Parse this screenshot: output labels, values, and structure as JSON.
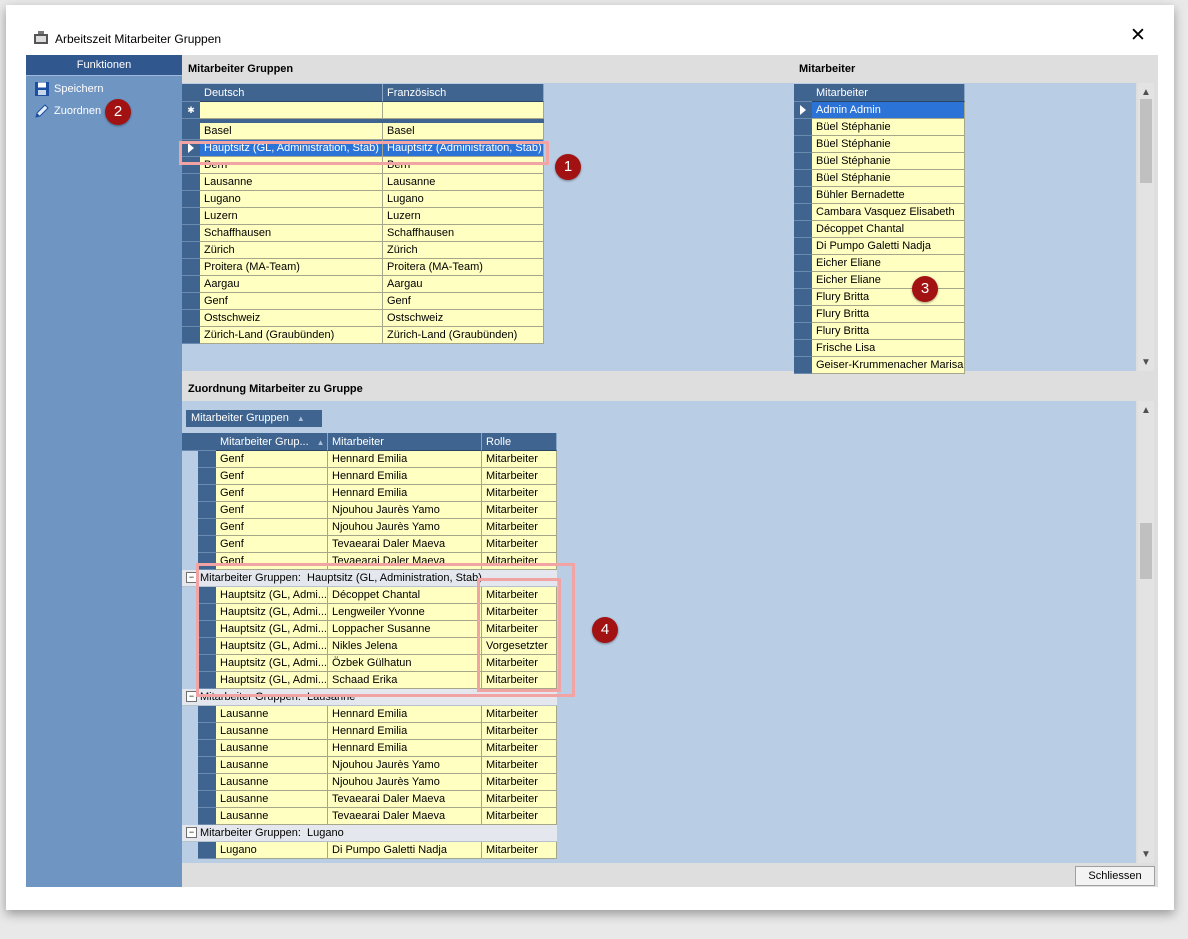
{
  "window": {
    "title": "Arbeitszeit Mitarbeiter Gruppen",
    "close_glyph": "✕"
  },
  "sidebar": {
    "header": "Funktionen",
    "items": [
      {
        "label": "Speichern",
        "icon": "save-icon"
      },
      {
        "label": "Zuordnen",
        "icon": "pencil-icon"
      }
    ]
  },
  "groups_section": {
    "title": "Mitarbeiter Gruppen",
    "columns": [
      "Deutsch",
      "Französisch"
    ],
    "new_row_glyph": "✱",
    "rows": [
      [
        "Basel",
        "Basel"
      ],
      [
        "Hauptsitz (GL, Administration, Stab)",
        "Hauptsitz (Administration, Stab)"
      ],
      [
        "Bern",
        "Bern"
      ],
      [
        "Lausanne",
        "Lausanne"
      ],
      [
        "Lugano",
        "Lugano"
      ],
      [
        "Luzern",
        "Luzern"
      ],
      [
        "Schaffhausen",
        "Schaffhausen"
      ],
      [
        "Zürich",
        "Zürich"
      ],
      [
        "Proitera (MA-Team)",
        "Proitera (MA-Team)"
      ],
      [
        "Aargau",
        "Aargau"
      ],
      [
        "Genf",
        "Genf"
      ],
      [
        "Ostschweiz",
        "Ostschweiz"
      ],
      [
        "Zürich-Land (Graubünden)",
        "Zürich-Land (Graubünden)"
      ]
    ],
    "selected_row": 1
  },
  "employees_section": {
    "title": "Mitarbeiter",
    "column": "Mitarbeiter",
    "rows": [
      "Admin Admin",
      "Büel Stéphanie",
      "Büel Stéphanie",
      "Büel Stéphanie",
      "Büel Stéphanie",
      "Bühler Bernadette",
      "Cambara Vasquez Elisabeth",
      "Décoppet Chantal",
      "Di Pumpo Galetti Nadja",
      "Eicher Eliane",
      "Eicher Eliane",
      "Flury Britta",
      "Flury Britta",
      "Flury Britta",
      "Frische Lisa",
      "Geiser-Krummenacher Marisa"
    ],
    "selected_row": 0
  },
  "assignment_section": {
    "title": "Zuordnung Mitarbeiter zu Gruppe",
    "group_by_tab": "Mitarbeiter Gruppen",
    "columns": [
      "Mitarbeiter Grup...",
      "Mitarbeiter",
      "Rolle"
    ],
    "group_label_prefix": "Mitarbeiter Gruppen:",
    "blocks": [
      {
        "type": "rows",
        "rows": [
          [
            "Genf",
            "Hennard Emilia",
            "Mitarbeiter"
          ],
          [
            "Genf",
            "Hennard Emilia",
            "Mitarbeiter"
          ],
          [
            "Genf",
            "Hennard Emilia",
            "Mitarbeiter"
          ],
          [
            "Genf",
            "Njouhou Jaurès Yamo",
            "Mitarbeiter"
          ],
          [
            "Genf",
            "Njouhou Jaurès Yamo",
            "Mitarbeiter"
          ],
          [
            "Genf",
            "Tevaearai Daler Maeva",
            "Mitarbeiter"
          ],
          [
            "Genf",
            "Tevaearai Daler Maeva",
            "Mitarbeiter"
          ]
        ]
      },
      {
        "type": "group",
        "name": "Hauptsitz (GL, Administration, Stab)"
      },
      {
        "type": "rows",
        "rows": [
          [
            "Hauptsitz (GL, Admi...",
            "Décoppet Chantal",
            "Mitarbeiter"
          ],
          [
            "Hauptsitz (GL, Admi...",
            "Lengweiler Yvonne",
            "Mitarbeiter"
          ],
          [
            "Hauptsitz (GL, Admi...",
            "Loppacher Susanne",
            "Mitarbeiter"
          ],
          [
            "Hauptsitz (GL, Admi...",
            "Nikles Jelena",
            "Vorgesetzter"
          ],
          [
            "Hauptsitz (GL, Admi...",
            "Özbek Gülhatun",
            "Mitarbeiter"
          ],
          [
            "Hauptsitz (GL, Admi...",
            "Schaad Erika",
            "Mitarbeiter"
          ]
        ]
      },
      {
        "type": "group",
        "name": "Lausanne"
      },
      {
        "type": "rows",
        "rows": [
          [
            "Lausanne",
            "Hennard Emilia",
            "Mitarbeiter"
          ],
          [
            "Lausanne",
            "Hennard Emilia",
            "Mitarbeiter"
          ],
          [
            "Lausanne",
            "Hennard Emilia",
            "Mitarbeiter"
          ],
          [
            "Lausanne",
            "Njouhou Jaurès Yamo",
            "Mitarbeiter"
          ],
          [
            "Lausanne",
            "Njouhou Jaurès Yamo",
            "Mitarbeiter"
          ],
          [
            "Lausanne",
            "Tevaearai Daler Maeva",
            "Mitarbeiter"
          ],
          [
            "Lausanne",
            "Tevaearai Daler Maeva",
            "Mitarbeiter"
          ]
        ]
      },
      {
        "type": "group",
        "name": "Lugano"
      },
      {
        "type": "rows",
        "rows": [
          [
            "Lugano",
            "Di Pumpo Galetti Nadja",
            "Mitarbeiter"
          ]
        ]
      }
    ]
  },
  "footer": {
    "close_button": "Schliessen"
  },
  "annotations": [
    "1",
    "2",
    "3",
    "4"
  ],
  "colors": {
    "sidebar": "#6f95c3",
    "header": "#3e648f",
    "cell": "#ffffc2",
    "selected": "#2b73d7",
    "marker": "#a31212",
    "highlight": "#f2a3a3"
  }
}
